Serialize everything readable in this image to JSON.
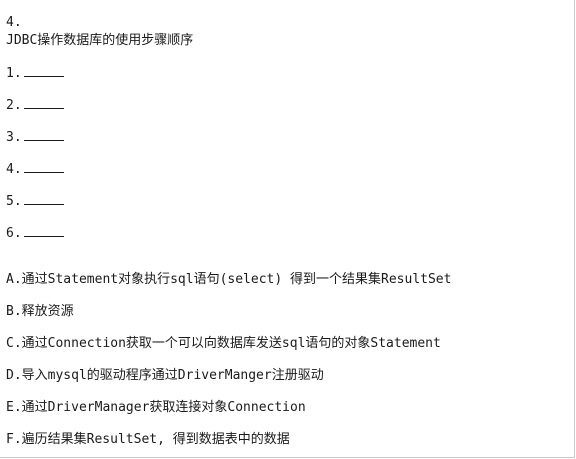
{
  "question": {
    "number": "4.",
    "title": "JDBC操作数据库的使用步骤顺序"
  },
  "steps": [
    {
      "label": "1."
    },
    {
      "label": "2."
    },
    {
      "label": "3."
    },
    {
      "label": "4."
    },
    {
      "label": "5."
    },
    {
      "label": "6."
    }
  ],
  "options": [
    {
      "text": "A.通过Statement对象执行sql语句(select) 得到一个结果集ResultSet"
    },
    {
      "text": "B.释放资源"
    },
    {
      "text": "C.通过Connection获取一个可以向数据库发送sql语句的对象Statement"
    },
    {
      "text": "D.导入mysql的驱动程序通过DriverManger注册驱动"
    },
    {
      "text": "E.通过DriverManager获取连接对象Connection"
    },
    {
      "text": "F.遍历结果集ResultSet, 得到数据表中的数据"
    }
  ]
}
